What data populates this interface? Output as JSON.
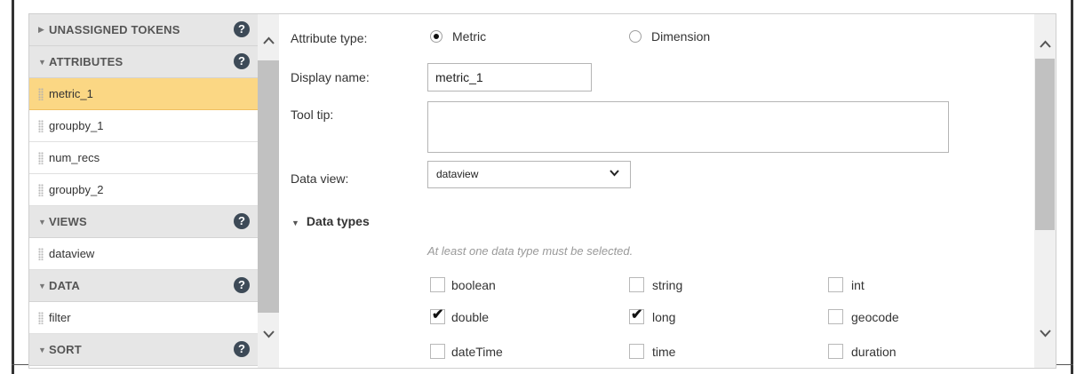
{
  "sidebar": {
    "sections": [
      {
        "label": "UNASSIGNED TOKENS",
        "expanded": false,
        "items": []
      },
      {
        "label": "ATTRIBUTES",
        "expanded": true,
        "items": [
          {
            "label": "metric_1",
            "selected": true
          },
          {
            "label": "groupby_1",
            "selected": false
          },
          {
            "label": "num_recs",
            "selected": false
          },
          {
            "label": "groupby_2",
            "selected": false
          }
        ]
      },
      {
        "label": "VIEWS",
        "expanded": true,
        "items": [
          {
            "label": "dataview",
            "selected": false
          }
        ]
      },
      {
        "label": "DATA",
        "expanded": true,
        "items": [
          {
            "label": "filter",
            "selected": false
          }
        ]
      },
      {
        "label": "SORT",
        "expanded": true,
        "items": []
      }
    ],
    "help_glyph": "?"
  },
  "form": {
    "attribute_type": {
      "label": "Attribute type:",
      "options": [
        "Metric",
        "Dimension"
      ],
      "selected": "Metric"
    },
    "display_name": {
      "label": "Display name:",
      "value": "metric_1"
    },
    "tool_tip": {
      "label": "Tool tip:",
      "value": ""
    },
    "data_view": {
      "label": "Data view:",
      "value": "dataview"
    },
    "data_types": {
      "heading": "Data types",
      "hint": "At least one data type must be selected.",
      "options": [
        {
          "label": "boolean",
          "checked": false
        },
        {
          "label": "string",
          "checked": false
        },
        {
          "label": "int",
          "checked": false
        },
        {
          "label": "double",
          "checked": true
        },
        {
          "label": "long",
          "checked": true
        },
        {
          "label": "geocode",
          "checked": false
        },
        {
          "label": "dateTime",
          "checked": false
        },
        {
          "label": "time",
          "checked": false
        },
        {
          "label": "duration",
          "checked": false
        }
      ]
    }
  },
  "icons": {
    "expanded": "triangle-down-icon",
    "collapsed": "triangle-right-icon",
    "scroll_up": "chevron-up-icon",
    "scroll_down": "chevron-down-icon",
    "help": "help-icon",
    "select_caret": "chevron-down-icon",
    "drag": "drag-handle-icon"
  },
  "colors": {
    "selected_item": "#fbd784",
    "section_header": "#e6e6e6",
    "help_icon": "#3d4a57"
  }
}
